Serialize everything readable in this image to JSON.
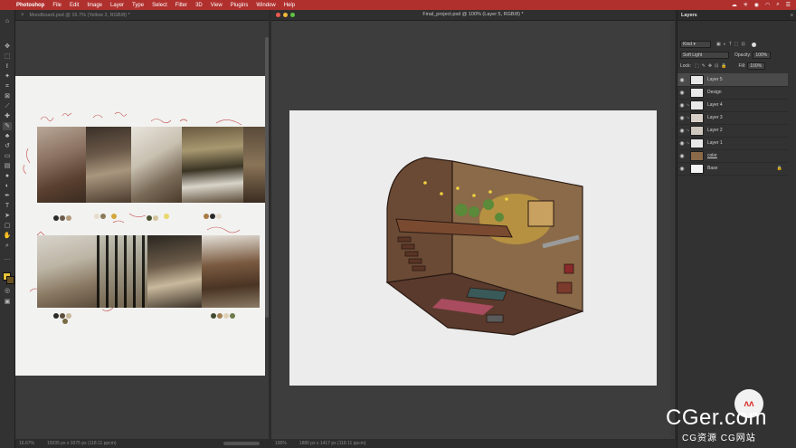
{
  "menubar": {
    "app": "Photoshop",
    "items": [
      "File",
      "Edit",
      "Image",
      "Layer",
      "Type",
      "Select",
      "Filter",
      "3D",
      "View",
      "Plugins",
      "Window",
      "Help"
    ],
    "status_icons": [
      "cloud-icon",
      "tools-icon",
      "lock-icon",
      "wifi-icon",
      "search-icon",
      "control-center-icon"
    ]
  },
  "doc1": {
    "tab_title": "Moodboard.psd @ 16.7% (Yellow 2, RGB/8) *",
    "zoom": "16.67%",
    "dimensions": "15035 px x 9375 px (118.11 ppcm)",
    "swatches_row1": [
      "#2c2a28",
      "#6b5a4a",
      "#b39a7c",
      "#e6dccb",
      "#8a7a5a",
      "#d4a73a",
      "#4a5230",
      "#d3c39c",
      "#a97c44",
      "#e8d86a"
    ],
    "swatches_row2": [
      "#2c2a28",
      "#5d4d3d",
      "#c9b79a",
      "#7a6a44",
      "#3f4a2e",
      "#a38054",
      "#e0d2b6",
      "#6e7a48"
    ]
  },
  "doc2": {
    "tab_title": "Final_project.psd @ 100% (Layer 5, RGB/8) *",
    "zoom": "100%",
    "dimensions": "1880 px x 1417 px (118.11 ppcm)"
  },
  "layers_panel": {
    "title": "Layers",
    "kind_label": "Kind",
    "blend_mode": "Soft Light",
    "opacity_label": "Opacity:",
    "opacity_value": "100%",
    "lock_label": "Lock:",
    "fill_label": "Fill:",
    "fill_value": "100%",
    "layers": [
      {
        "name": "Layer 5",
        "selected": true
      },
      {
        "name": "Design",
        "selected": false
      },
      {
        "name": "Layer 4",
        "selected": false
      },
      {
        "name": "Layer 3",
        "selected": false
      },
      {
        "name": "Layer 2",
        "selected": false
      },
      {
        "name": "Layer 1",
        "selected": false
      },
      {
        "name": "color",
        "selected": false
      },
      {
        "name": "Base",
        "selected": false
      }
    ]
  },
  "watermark": {
    "logo": "CGer.com",
    "subtitle": "CG资源  CG网站"
  },
  "colors": {
    "menubar": "#b0302e",
    "accent_yellow": "#e8c23a"
  }
}
